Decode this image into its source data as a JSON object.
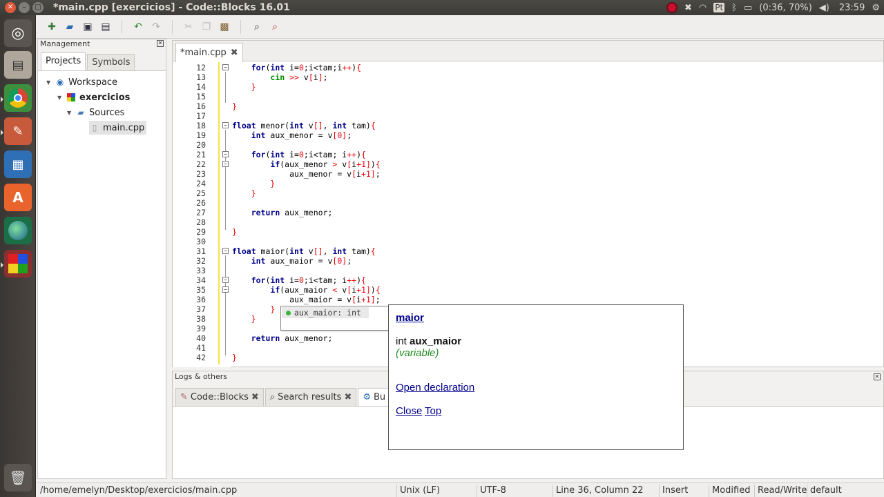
{
  "window": {
    "title": "*main.cpp [exercicios] - Code::Blocks 16.01"
  },
  "tray": {
    "keyboard": "Pt",
    "battery": "(0:36, 70%)",
    "clock": "23:59"
  },
  "launcher": {
    "items": [
      "ubuntu-dash-icon",
      "files-icon",
      "chrome-icon",
      "text-editor-icon",
      "document-viewer-icon",
      "software-center-icon",
      "globe-icon",
      "codeblocks-icon",
      "trash-icon"
    ]
  },
  "management": {
    "title": "Management",
    "tabs": [
      "Projects",
      "Symbols"
    ],
    "tree": {
      "workspace": "Workspace",
      "project": "exercicios",
      "folder": "Sources",
      "file": "main.cpp"
    }
  },
  "editor": {
    "tab_label": "*main.cpp"
  },
  "autocomplete": {
    "item": "aux_maior: int"
  },
  "doc": {
    "title": "maior",
    "sig_type": "int",
    "sig_name": "aux_maior",
    "kind": "(variable)",
    "open_declaration": "Open declaration",
    "close": "Close",
    "top": "Top"
  },
  "logs": {
    "title": "Logs & others",
    "tabs": [
      "Code::Blocks",
      "Search results",
      "Bu"
    ]
  },
  "status": {
    "path": "/home/emelyn/Desktop/exercicios/main.cpp",
    "eol": "Unix (LF)",
    "encoding": "UTF-8",
    "position": "Line 36, Column 22",
    "mode": "Insert",
    "modified": "Modified",
    "access": "Read/Write",
    "profile": "default"
  }
}
